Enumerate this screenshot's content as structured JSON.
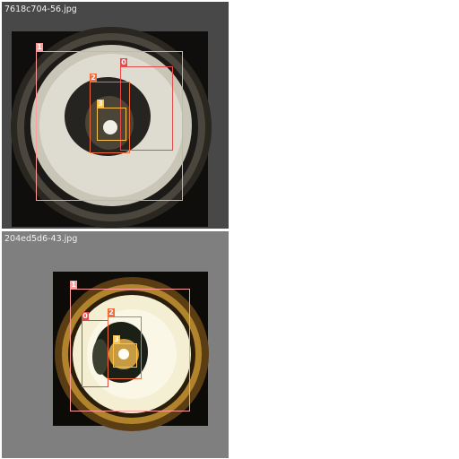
{
  "tiles": [
    {
      "filename": "7618c704-56.jpg",
      "labels": [
        "1",
        "0",
        "2",
        "3"
      ]
    },
    {
      "filename": "204ed5d6-43.jpg",
      "labels": [
        "1",
        "0",
        "2",
        "3"
      ]
    }
  ],
  "colors": {
    "class_0": "#e64b4b",
    "class_1": "#ff9c9c",
    "class_2": "#f26b3a",
    "class_3": "#ffc24a"
  }
}
